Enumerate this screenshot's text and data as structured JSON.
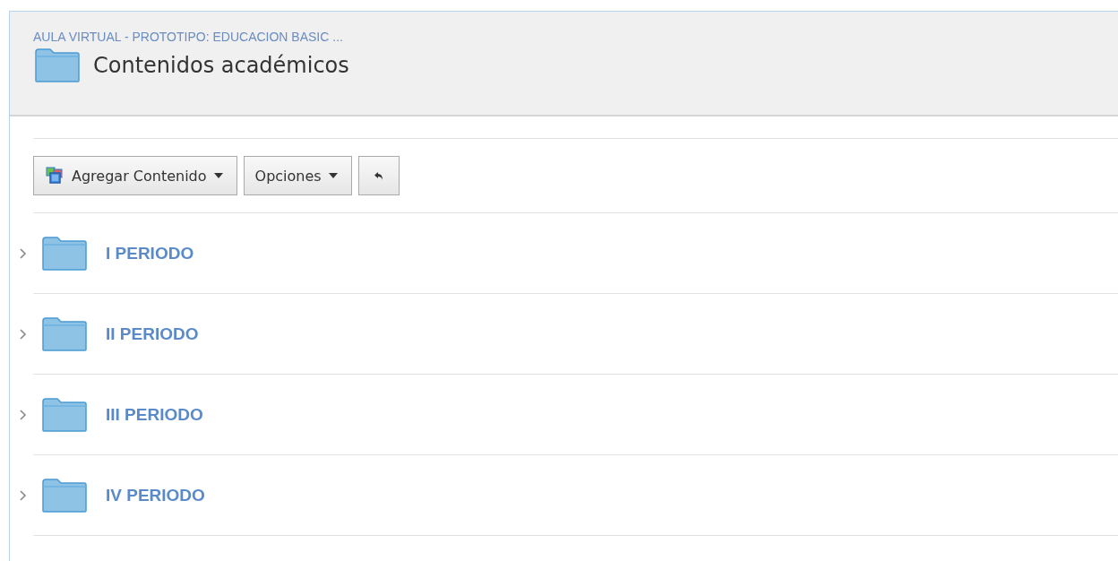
{
  "breadcrumb": "AULA VIRTUAL - PROTOTIPO: EDUCACION BASIC ...",
  "title": "Contenidos académicos",
  "toolbar": [
    {
      "kind": "menu",
      "label": "Agregar Contenido",
      "icon": true
    },
    {
      "kind": "menu",
      "label": "Opciones",
      "icon": false
    },
    {
      "kind": "back"
    }
  ],
  "folders": [
    {
      "label": "I PERIODO",
      "expanded": false
    },
    {
      "label": "II PERIODO",
      "expanded": false
    },
    {
      "label": "III PERIODO",
      "expanded": false
    },
    {
      "label": "IV PERIODO",
      "expanded": false
    }
  ]
}
